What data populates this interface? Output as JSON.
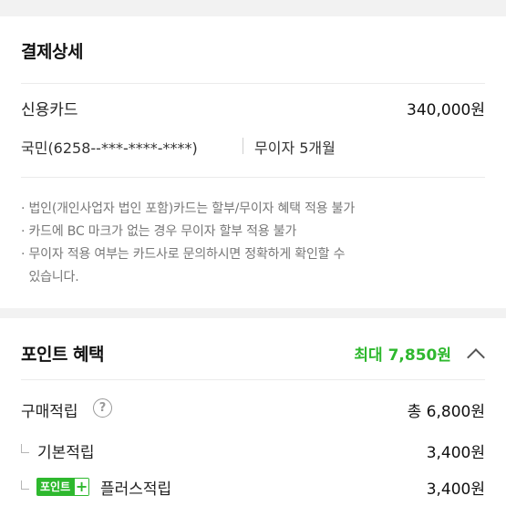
{
  "payment": {
    "title": "결제상세",
    "method_label": "신용카드",
    "amount": "340,000원",
    "card_info": "국민(6258--***-****-****)",
    "installment": "무이자 5개월",
    "notes": [
      "· 법인(개인사업자 법인 포함)카드는 할부/무이자 혜택 적용 불가",
      "· 카드에 BC 마크가 없는 경우 무이자 할부 적용 불가",
      "· 무이자 적용 여부는 카드사로 문의하시면 정확하게 확인할 수",
      "  있습니다."
    ]
  },
  "points": {
    "title": "포인트 혜택",
    "max_label": "최대 7,850원",
    "purchase_label": "구매적립",
    "purchase_value": "총 6,800원",
    "basic_label": "기본적립",
    "basic_value": "3,400원",
    "badge_text": "포인트",
    "badge_plus": "+",
    "plus_label": "플러스적립",
    "plus_value": "3,400원"
  },
  "icons": {
    "help": "?"
  },
  "colors": {
    "accent_green": "#2eb82e",
    "background": "#f2f2f2"
  }
}
